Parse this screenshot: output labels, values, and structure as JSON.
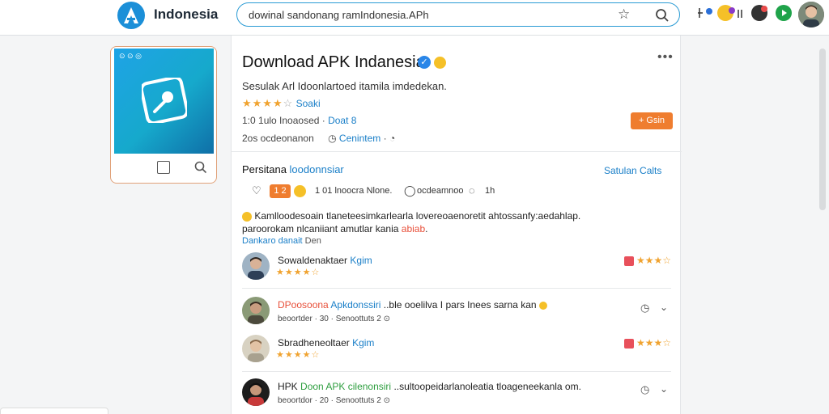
{
  "header": {
    "brand": "Indonesia",
    "search_value": "dowinal sandonang ramIndonesia.APh",
    "colors": {
      "accent": "#1b8fd8",
      "search_border": "#2a9bd4"
    }
  },
  "app_card": {
    "mini_label": "⊙ ⊙  ◎"
  },
  "app": {
    "title": "Download APK Indanesia",
    "description": "Sesulak Arl Idoonlartoed itamila imdedekan.",
    "rating_text": "Soaki",
    "stat_line1": "1:0 1ulo Inoaosed  ·",
    "stat_line1_link": "Doat 8",
    "stat_line2": "2os ocdeonanon",
    "stat_line2_link": "Cenintem",
    "install_button": "+ Gsin",
    "rating_value": 4
  },
  "reviews_section": {
    "title": "Persitana",
    "title_link": "loodonnsiar",
    "see_all": "Satulan Calts",
    "reactions": {
      "badge": "1 2",
      "text1": "1 01 lnoocra Nlone.",
      "text2": "ocdeamnoo",
      "text3": "1h"
    },
    "paragraph": "Kamlloodesoain tlaneteesimkarlearla lovereoaenoretit ahtossanfy:aedahlap. paroorokam nlcaniiant amutlar kania",
    "paragraph_highlight": "abiab",
    "sub": "Dankaro danait",
    "sub2": "Den"
  },
  "reviews": [
    {
      "name": "Sowaldenaktaer",
      "name_link": "Kgim",
      "sub": "",
      "stars": 4,
      "right_stars": 3
    },
    {
      "name": "DPoosoona",
      "name_link": "Apkdonssiri",
      "name_tail": "..ble ooelilva I pars Inees sarna kan",
      "sub": "beoortder  ·  30  ·  Senoottuts   2 ⊙",
      "stars": 0,
      "right_stars": 0
    },
    {
      "name": "Sbradheneoltaer",
      "name_link": "Kgim",
      "sub": "",
      "stars": 4,
      "right_stars": 3
    },
    {
      "name": "HPK",
      "name_link": "Doon APK cilenonsiri",
      "name_tail": "..sultoopeidarlanoleatia tloageneekanla om.",
      "sub": "beoortdor  ·  20  ·  Senoottuts   2 ⊙",
      "stars": 0,
      "right_stars": 0
    }
  ]
}
